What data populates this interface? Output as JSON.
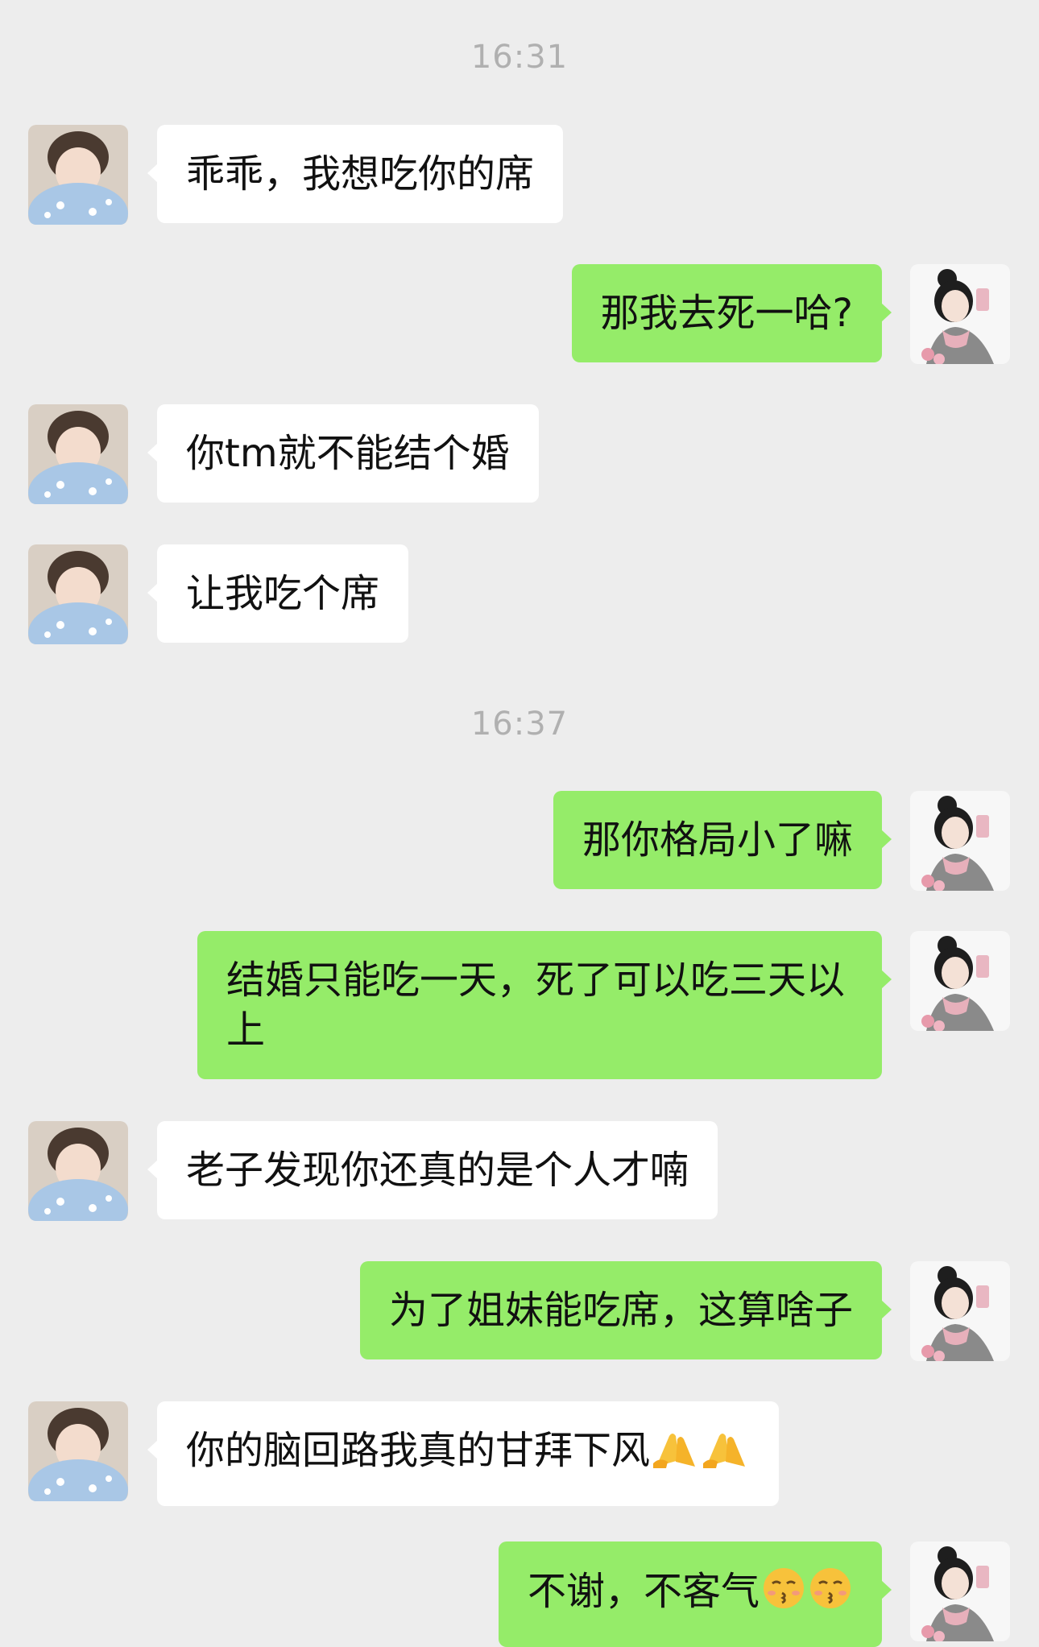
{
  "timestamps": [
    "16:31",
    "16:37"
  ],
  "messages": [
    {
      "side": "left",
      "text": "乖乖，我想吃你的席"
    },
    {
      "side": "right",
      "text": "那我去死一哈?"
    },
    {
      "side": "left",
      "text": "你tm就不能结个婚"
    },
    {
      "side": "left",
      "text": "让我吃个席"
    },
    {
      "side": "right",
      "text": "那你格局小了嘛"
    },
    {
      "side": "right",
      "text": "结婚只能吃一天，死了可以吃三天以上"
    },
    {
      "side": "left",
      "text": "老子发现你还真的是个人才喃"
    },
    {
      "side": "right",
      "text": "为了姐妹能吃席，这算啥子"
    },
    {
      "side": "left",
      "text": "你的脑回路我真的甘拜下风",
      "emoji": "folded-hands-icon x2"
    },
    {
      "side": "right",
      "text": "不谢，不客气",
      "emoji": "kissing-face-icon x2"
    }
  ],
  "colors": {
    "background": "#ededed",
    "incoming_bubble": "#ffffff",
    "outgoing_bubble": "#95ec69",
    "timestamp": "#b0b0b0"
  }
}
